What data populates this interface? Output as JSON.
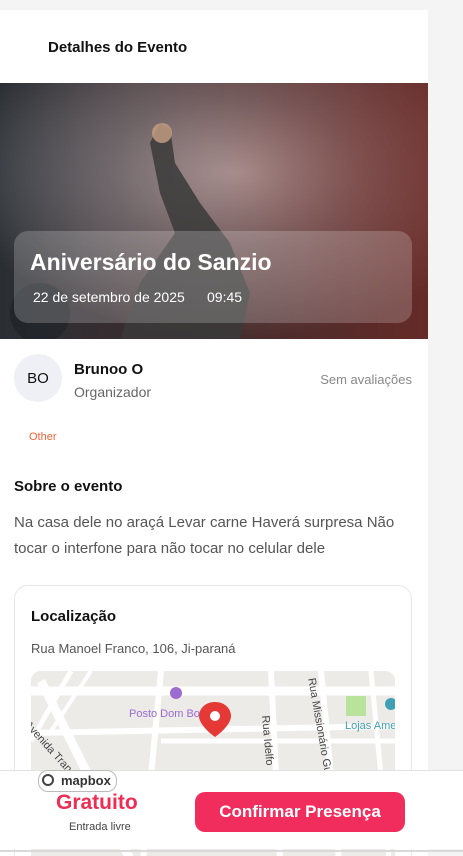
{
  "header": {
    "title": "Detalhes do Evento"
  },
  "event": {
    "title": "Aniversário do Sanzio",
    "date": "22 de setembro de 2025",
    "time": "09:45",
    "category": "Other"
  },
  "organizer": {
    "initials": "BO",
    "name": "Brunoo O",
    "role": "Organizador",
    "rating_text": "Sem avaliações"
  },
  "about": {
    "heading": "Sobre o evento",
    "text": "Na casa dele no araçá Levar carne Haverá surpresa Não tocar o interfone para não tocar no celular dele"
  },
  "location": {
    "heading": "Localização",
    "address": "Rua Manoel Franco, 106, Ji-paraná",
    "map": {
      "poi_1": "Posto Dom Bo",
      "poi_2": "Lojas Ame",
      "street_1": "Avenida Transcon",
      "street_2": "Rua Idelfo",
      "street_3": "Rua Missionário Gu",
      "attribution": "mapbox"
    }
  },
  "footer": {
    "price": "Gratuito",
    "price_note": "Entrada livre",
    "confirm_label": "Confirmar Presença"
  },
  "colors": {
    "accent": "#f02d5c",
    "price": "#ee2d55",
    "tag": "#f0623a",
    "map_pin": "#e53935"
  }
}
